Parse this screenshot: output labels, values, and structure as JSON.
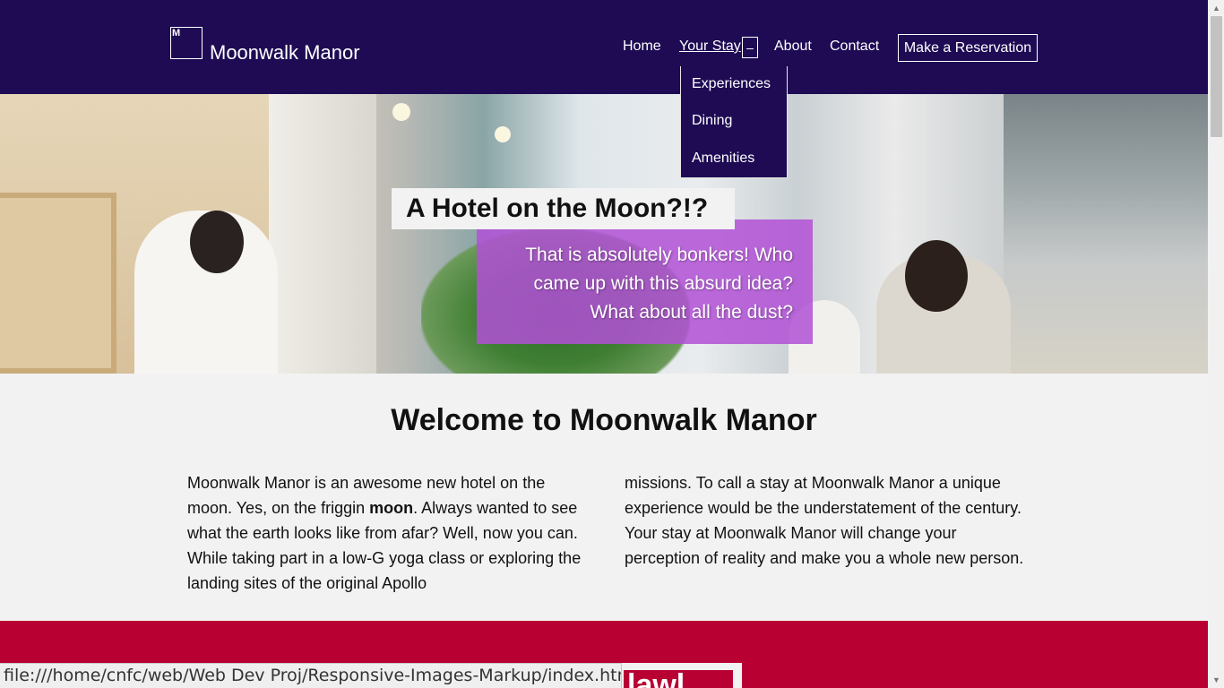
{
  "header": {
    "logo_text": "M",
    "brand": "Moonwalk Manor",
    "nav": {
      "home": "Home",
      "your_stay": "Your Stay",
      "toggle": "–",
      "about": "About",
      "contact": "Contact"
    },
    "reserve_button": "Make a Reservation",
    "dropdown": [
      "Experiences",
      "Dining",
      "Amenities"
    ]
  },
  "hero": {
    "title": "A Hotel on the Moon?!?",
    "subtitle": "That is absolutely bonkers! Who came up with this absurd idea? What about all the dust?"
  },
  "welcome": {
    "title": "Welcome to Moonwalk Manor",
    "col1_before": "Moonwalk Manor is an awesome new hotel on the moon. Yes, on the friggin ",
    "col1_bold": "moon",
    "col1_after": ". Always wanted to see what the earth looks like from afar? Well, now you can. While taking part in a low-G yoga class or exploring the landing sites of the original Apollo",
    "col2": "missions. To call a stay at Moonwalk Manor a unique experience would be the understatement of the century. Your stay at Moonwalk Manor will change your perception of reality and make you a whole new person."
  },
  "next_section": {
    "partial_heading": "lawl"
  },
  "statusbar": {
    "url": "file:///home/cnfc/web/Web Dev Proj/Responsive-Images-Markup/index.html#"
  },
  "colors": {
    "header_bg": "#1e0b54",
    "hero_subtitle_bg": "#b250d6",
    "band_red": "#b80033"
  }
}
